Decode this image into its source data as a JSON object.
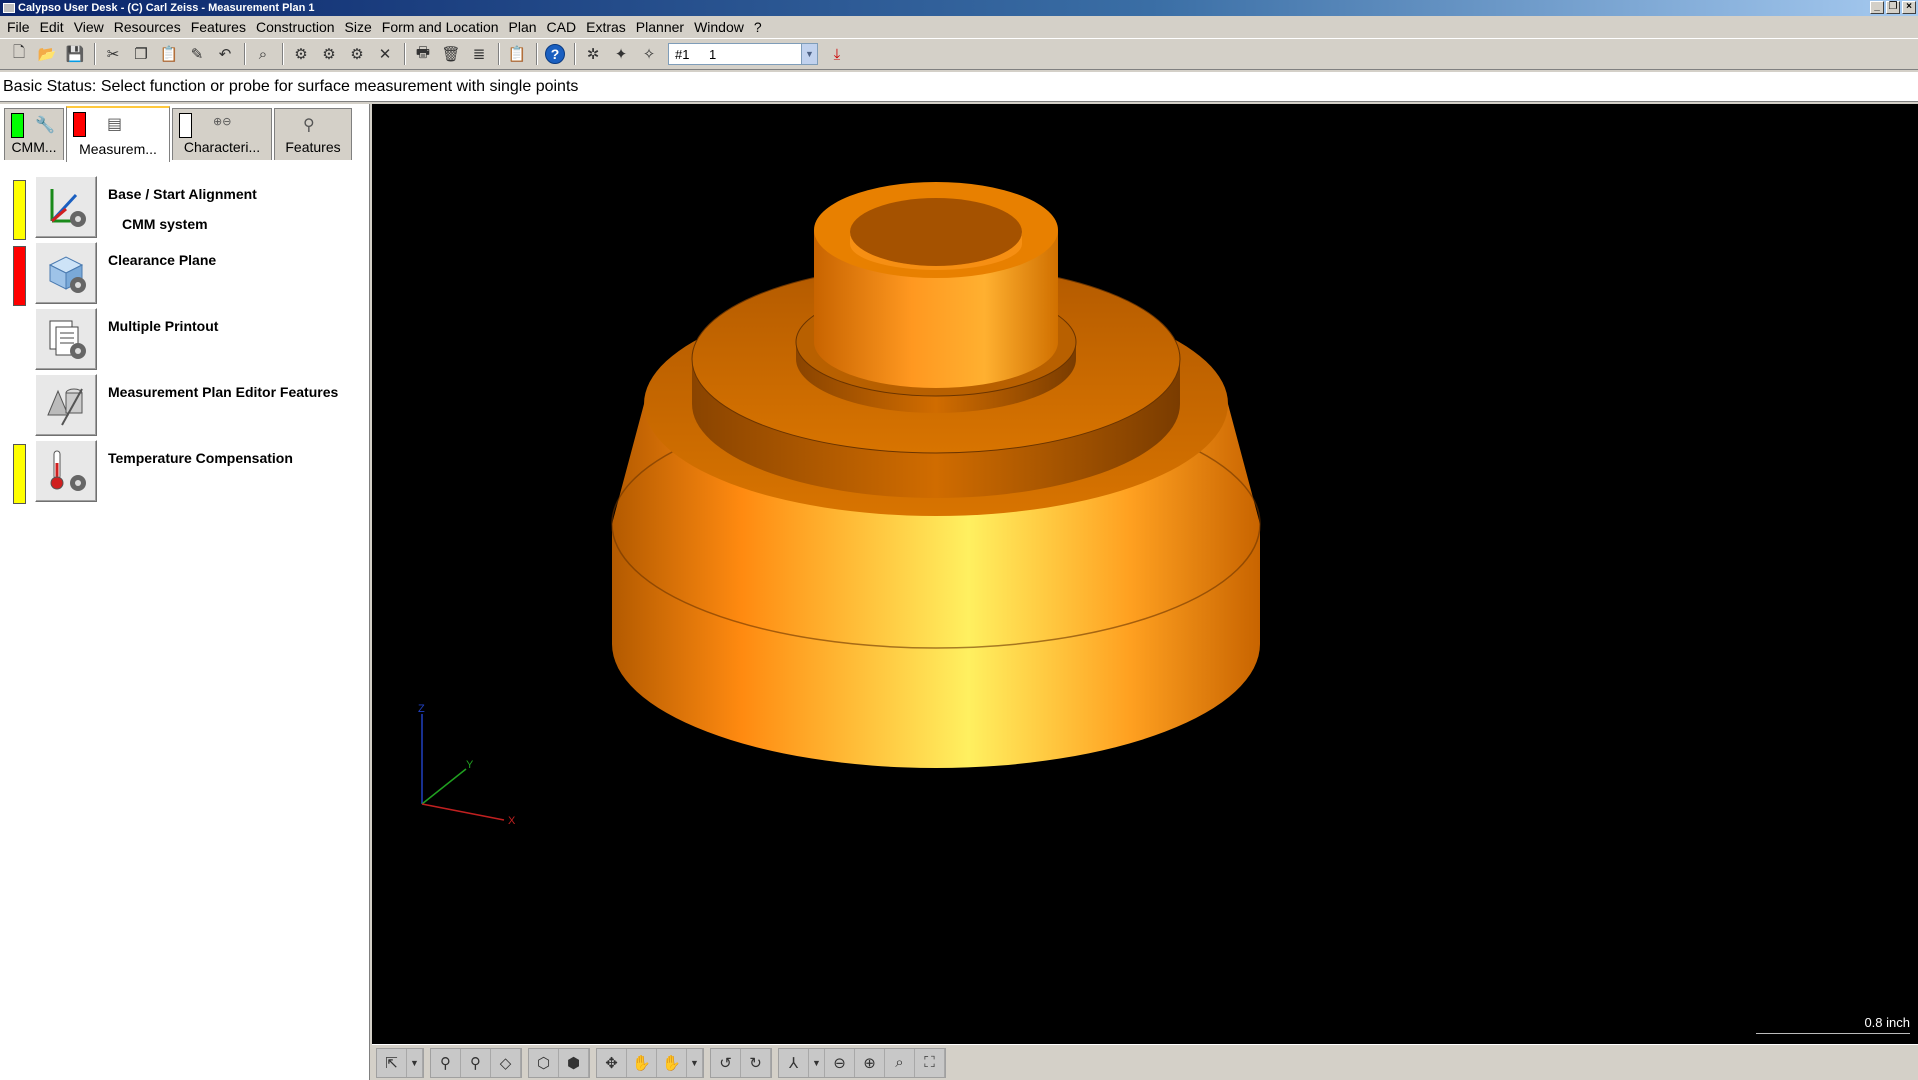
{
  "window": {
    "title": "Calypso User Desk - (C) Carl Zeiss - Measurement Plan 1"
  },
  "menu": [
    "File",
    "Edit",
    "View",
    "Resources",
    "Features",
    "Construction",
    "Size",
    "Form and Location",
    "Plan",
    "CAD",
    "Extras",
    "Planner",
    "Window",
    "?"
  ],
  "toolbar": {
    "combo_prefix": "#1",
    "combo_value": "1"
  },
  "status": {
    "text": "Basic Status: Select function or probe for surface measurement with single points"
  },
  "tabs": [
    {
      "label": "CMM...",
      "color": "#00ff00"
    },
    {
      "label": "Measurem...",
      "color": "#ff0000"
    },
    {
      "label": "Characteri...",
      "color": "#ffffff"
    },
    {
      "label": "Features"
    }
  ],
  "tasks": [
    {
      "label": "Base / Start Alignment",
      "sub": "CMM system",
      "status_color": "#ffff00",
      "icon": "alignment-icon"
    },
    {
      "label": "Clearance Plane",
      "status_color": "#ff0000",
      "icon": "clearance-plane-icon"
    },
    {
      "label": "Multiple Printout",
      "icon": "printout-icon"
    },
    {
      "label": "Measurement Plan Editor Features",
      "icon": "editor-features-icon"
    },
    {
      "label": "Temperature Compensation",
      "status_color": "#ffff00",
      "icon": "thermometer-icon"
    }
  ],
  "viewport": {
    "scale_label": "0.8 inch",
    "axes": {
      "x": "X",
      "y": "Y",
      "z": "Z"
    },
    "model_color": "#ff9a10"
  }
}
